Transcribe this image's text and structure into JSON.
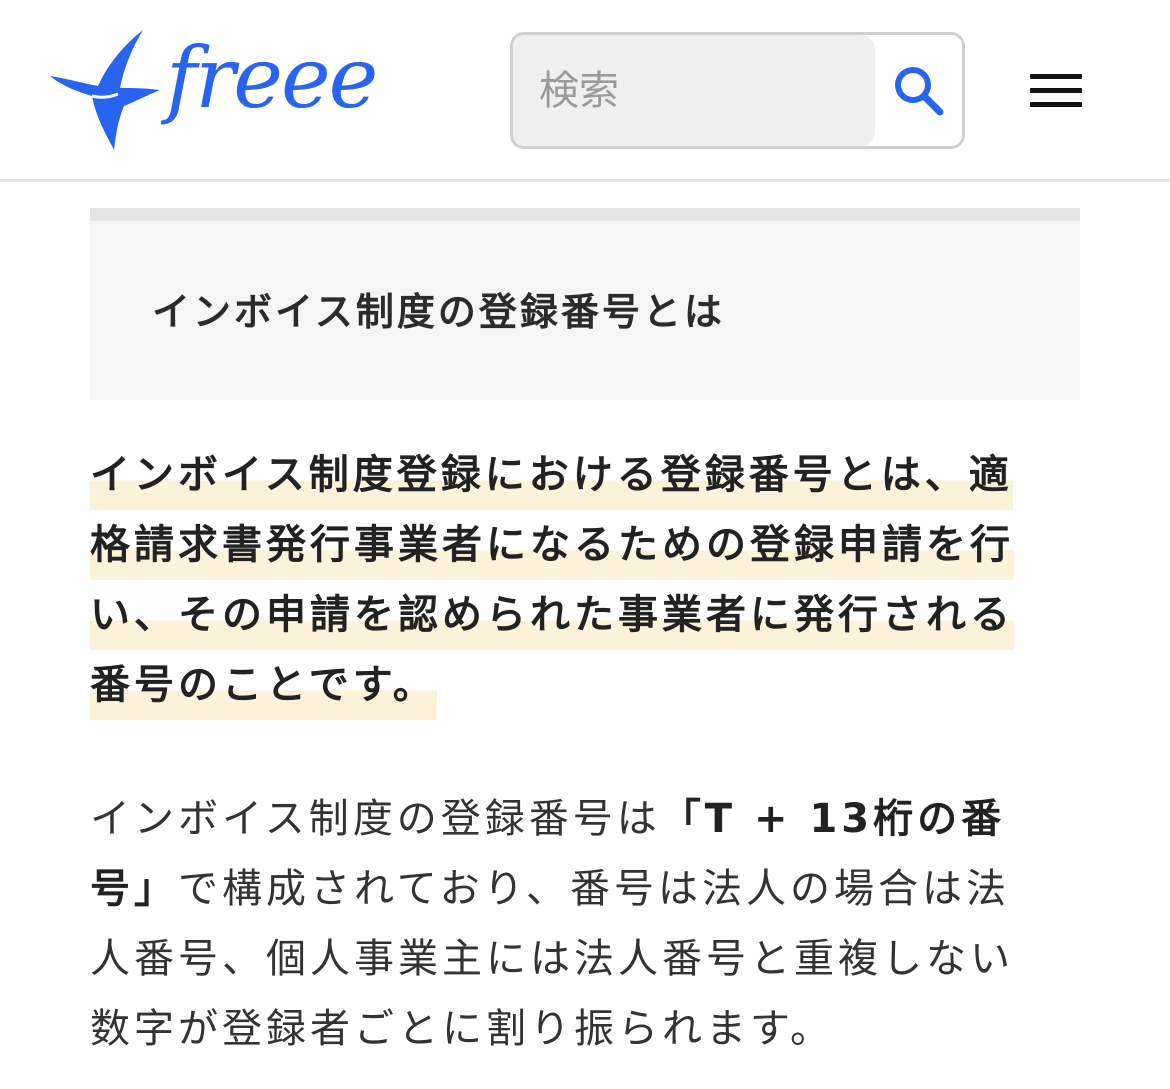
{
  "header": {
    "logo_text": "freee",
    "brand_color": "#2864F0",
    "search": {
      "placeholder": "検索",
      "value": ""
    },
    "search_icon": "search-icon",
    "menu_icon": "hamburger-menu-icon"
  },
  "article": {
    "heading": "インボイス制度の登録番号とは",
    "lead_lines": [
      "インボイス制度登録における登録番号とは、適",
      "格請求書発行事業者になるための登録申請を行",
      "い、その申請を認められた事業者に発行される",
      "番号のことです。"
    ],
    "highlight_color": "#fcf1d9",
    "body": {
      "line1_prefix": "インボイス制度の登録番号は",
      "line1_bold": "「T + 13桁の番",
      "line2_bold": "号」",
      "line2_rest": "で構成されており、番号は法人の場合は法",
      "line3": "人番号、個人事業主には法人番号と重複しない",
      "line4": "数字が登録者ごとに割り振られます。"
    }
  }
}
